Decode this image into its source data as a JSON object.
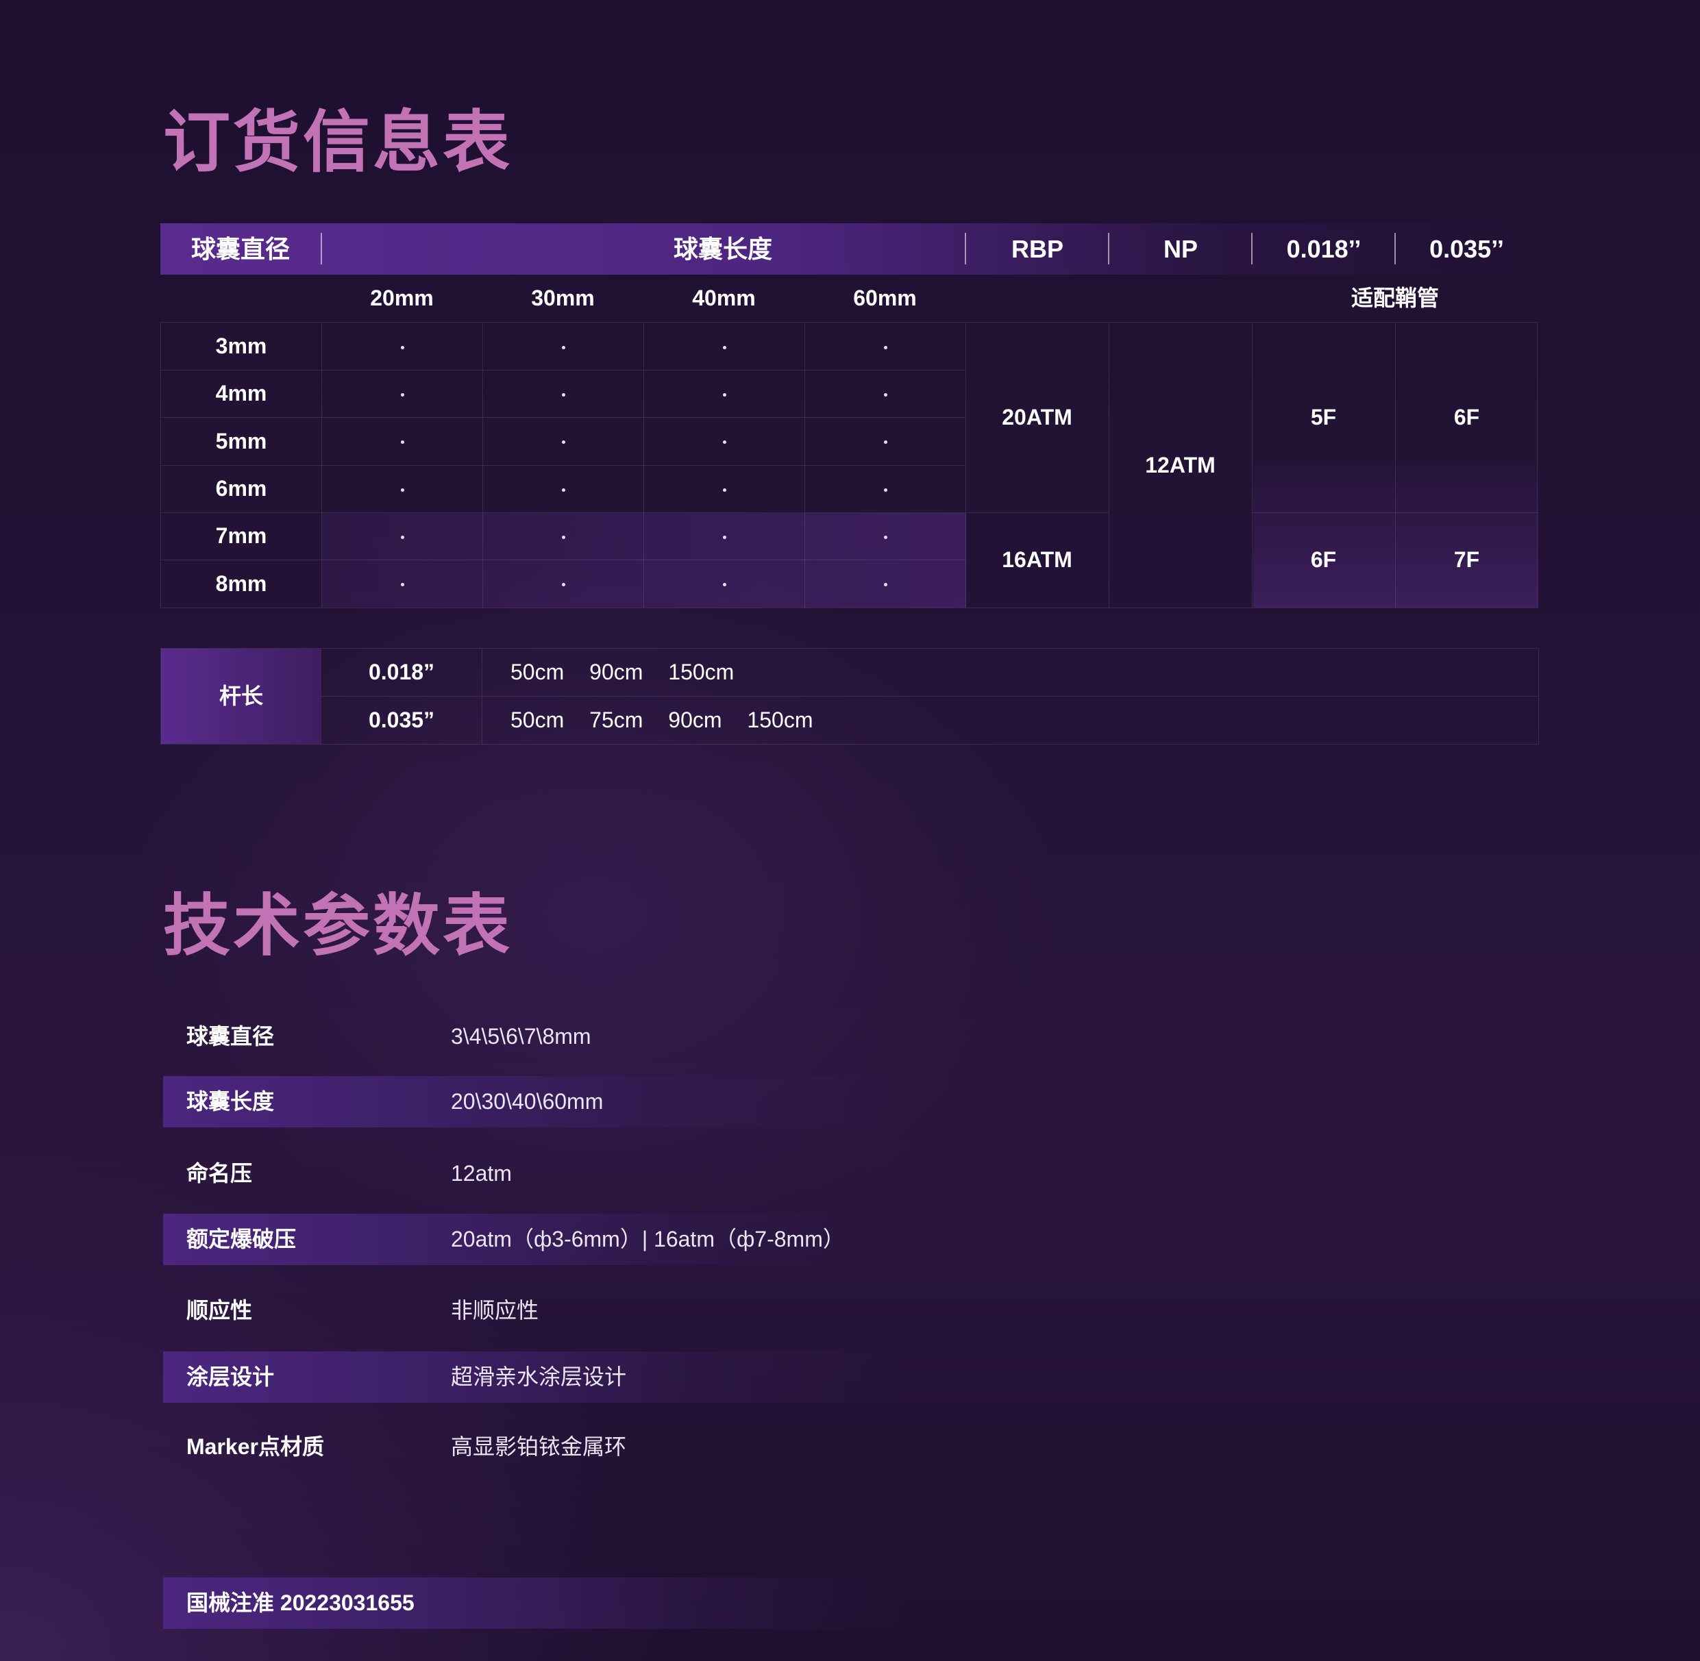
{
  "order": {
    "title": "订货信息表",
    "head": {
      "diameter": "球囊直径",
      "length": "球囊长度",
      "rbp": "RBP",
      "np": "NP",
      "g018": "0.018’’",
      "g035": "0.035’’"
    },
    "lengths": [
      "20mm",
      "30mm",
      "40mm",
      "60mm"
    ],
    "sheath_label": "适配鞘管",
    "rows": [
      "3mm",
      "4mm",
      "5mm",
      "6mm",
      "7mm",
      "8mm"
    ],
    "rbp_values": [
      "20ATM",
      "16ATM"
    ],
    "np_value": "12ATM",
    "sheath": {
      "upper": [
        "5F",
        "6F"
      ],
      "lower": [
        "6F",
        "7F"
      ]
    }
  },
  "shaft": {
    "label": "杆长",
    "rows": [
      {
        "guide": "0.018”",
        "values": [
          "50cm",
          "90cm",
          "150cm"
        ]
      },
      {
        "guide": "0.035”",
        "values": [
          "50cm",
          "75cm",
          "90cm",
          "150cm"
        ]
      }
    ]
  },
  "tech": {
    "title": "技术参数表",
    "rows": [
      {
        "key": "球囊直径",
        "value": "3\\4\\5\\6\\7\\8mm"
      },
      {
        "key": "球囊长度",
        "value": "20\\30\\40\\60mm"
      },
      {
        "key": "命名压",
        "value": "12atm"
      },
      {
        "key": "额定爆破压",
        "value": "20atm（ф3-6mm）| 16atm（ф7-8mm）"
      },
      {
        "key": "顺应性",
        "value": "非顺应性"
      },
      {
        "key": "涂层设计",
        "value": "超滑亲水涂层设计"
      },
      {
        "key": "Marker点材质",
        "value": "高显影铂铱金属环"
      }
    ]
  },
  "registration": "国械注准 20223031655"
}
